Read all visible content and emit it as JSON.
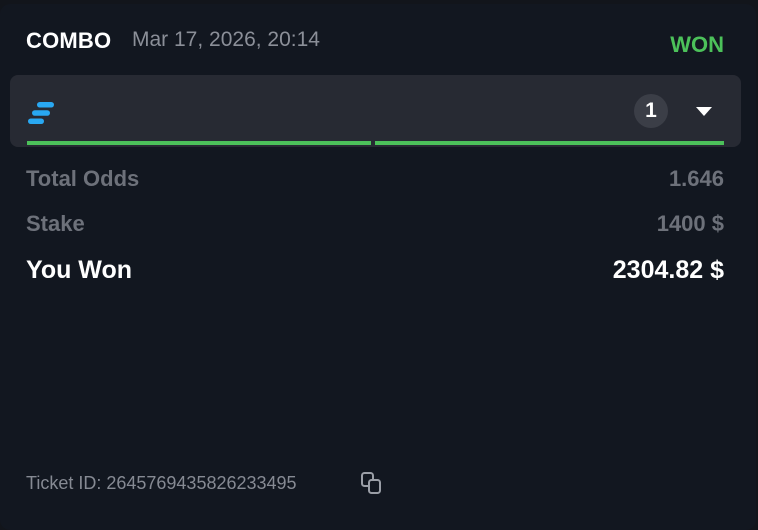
{
  "ticket": {
    "type": "COMBO",
    "date": "Mar 17, 2026, 20:14",
    "status": "WON",
    "status_color": "#4cc15a",
    "accent_color": "#29a8f2",
    "selection_count": "1",
    "selection_progress": [
      1,
      1
    ],
    "summary": {
      "total_odds_label": "Total Odds",
      "total_odds_value": "1.646",
      "stake_label": "Stake",
      "stake_value": "1400 $",
      "won_label": "You Won",
      "won_value": "2304.82 $"
    },
    "ticket_id_text": "Ticket ID: 2645769435826233495"
  },
  "icons": {
    "brand": "sportsbook-logo-icon",
    "expand": "chevron-down-icon",
    "copy": "copy-icon"
  }
}
